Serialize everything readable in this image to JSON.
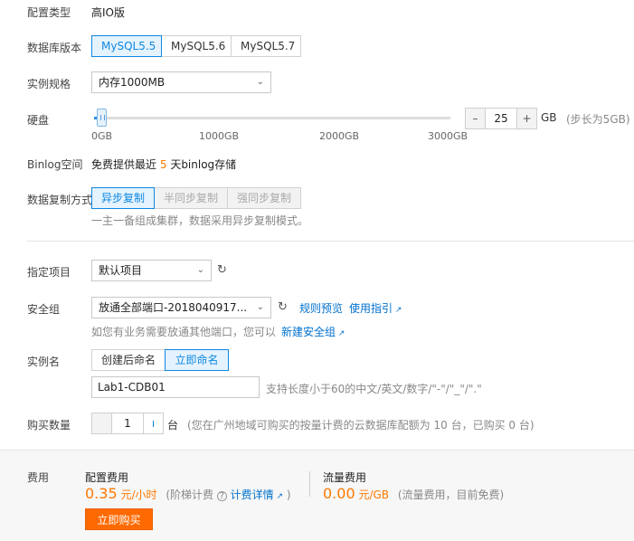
{
  "config_type": {
    "label": "配置类型",
    "value": "高IO版"
  },
  "db_version": {
    "label": "数据库版本",
    "options": [
      "MySQL5.5",
      "MySQL5.6",
      "MySQL5.7"
    ],
    "selected": "MySQL5.5"
  },
  "instance_spec": {
    "label": "实例规格",
    "value": "内存1000MB"
  },
  "disk": {
    "label": "硬盘",
    "ticks": [
      "0GB",
      "1000GB",
      "2000GB",
      "3000GB"
    ],
    "value": "25",
    "fraction": 0.008,
    "minus": "–",
    "plus": "+",
    "unit": "GB",
    "step_hint": "(步长为5GB)"
  },
  "binlog": {
    "label": "Binlog空间",
    "prefix": "免费提供最近",
    "days": "5",
    "suffix": "天binlog存储"
  },
  "replication": {
    "label": "数据复制方式",
    "options": [
      "异步复制",
      "半同步复制",
      "强同步复制"
    ],
    "selected": "异步复制",
    "desc": "一主一备组成集群，数据采用异步复制模式。"
  },
  "project": {
    "label": "指定项目",
    "value": "默认项目"
  },
  "security_group": {
    "label": "安全组",
    "value": "放通全部端口-2018040917...",
    "rules_link": "规则预览",
    "guide_link": "使用指引",
    "hint": "如您有业务需要放通其他端口，您可以",
    "create_link": "新建安全组"
  },
  "instance_name": {
    "label": "实例名",
    "options": [
      "创建后命名",
      "立即命名"
    ],
    "selected": "立即命名",
    "value": "Lab1-CDB01",
    "hint": "支持长度小于60的中文/英文/数字/\"-\"/\"_\"/\".\""
  },
  "quantity": {
    "label": "购买数量",
    "value": "1",
    "unit": "台",
    "hint": "(您在广州地域可购买的按量计费的云数据库配额为 10 台，已购买 0 台)"
  },
  "fees": {
    "label": "费用",
    "config": {
      "title": "配置费用",
      "amount": "0.35",
      "unit": "元/小时",
      "note": "(阶梯计费",
      "detail_link": "计费详情",
      "close": ")"
    },
    "traffic": {
      "title": "流量费用",
      "amount": "0.00",
      "unit": "元/GB",
      "note": "(流量费用，目前免费)"
    },
    "buy_button": "立即购买"
  },
  "colors": {
    "accent": "#0f88e0",
    "orange": "#ff7800",
    "buy": "#ff6a00"
  }
}
